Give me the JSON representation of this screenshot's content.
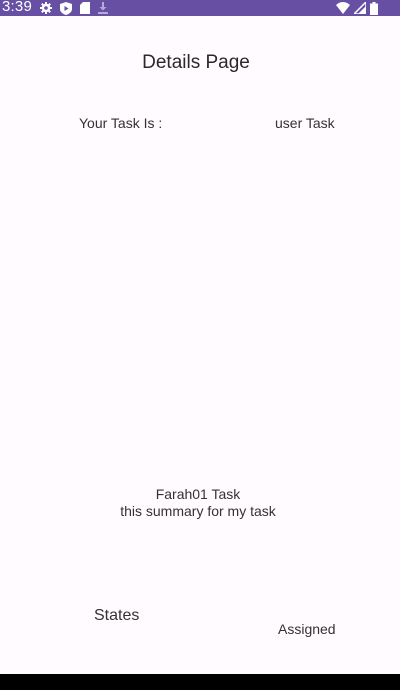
{
  "status_bar": {
    "time": "3:39",
    "left_icons": [
      "gear-icon",
      "shield-play-icon",
      "sd-card-icon",
      "download-icon"
    ],
    "right_icons": [
      "wifi-icon",
      "signal-icon",
      "battery-icon"
    ],
    "color": "#6750a4"
  },
  "page": {
    "title": "Details Page",
    "task_label": "Your Task Is :",
    "task_value": "user Task",
    "summary_title": "Farah01 Task",
    "summary_text": "this summary for my task",
    "states_label": "States",
    "states_value": "Assigned"
  },
  "colors": {
    "background": "#fffbfe",
    "text": "#333333",
    "nav_bar": "#000000"
  }
}
